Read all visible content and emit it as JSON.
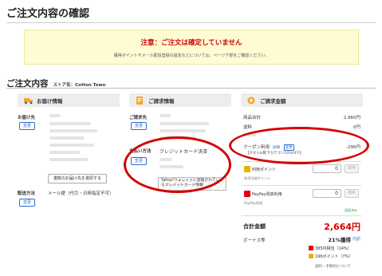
{
  "page": {
    "title": "ご注文内容の確認"
  },
  "notice": {
    "title": "注意：ご注文は確定していません",
    "message": "獲得ポイントやメール配信登録の設定などについては、ページ下部をご確認ください。"
  },
  "order": {
    "heading": "ご注文内容",
    "store_label": "ストア名：Cotton Town"
  },
  "delivery": {
    "header": "お届け情報",
    "destination_label": "お届け先",
    "change_label": "変更",
    "select_other_button": "複数のお届け先を選択する",
    "method_label": "配送方法",
    "method_value": "メール便（代引・日時指定不可）"
  },
  "billing": {
    "header": "ご請求情報",
    "billing_label": "ご請求先",
    "change_label": "変更",
    "payment_label": "支払い方法",
    "payment_value": "クレジットカード決済",
    "yahoo_wallet_note": "Yahoo!ウォレットに登録されているクレジットカード情報"
  },
  "amount": {
    "header": "ご請求金額",
    "subtotal_label": "商品合計",
    "subtotal_value": "2,960円",
    "shipping_label": "送料",
    "shipping_value": "0円",
    "coupon_label": "クーポン利用",
    "coupon_detail_label": "詳細",
    "coupon_change_label": "変更",
    "coupon_value": "-296円",
    "coupon_desc": "【タオル&靴下カテゴリ10%OFF】",
    "points_label": "利用ポイント",
    "points_value": "0",
    "points_apply": "適用",
    "points_note": "利用可能ポイント",
    "paypay_label": "PayPay残高利用",
    "paypay_value": "0",
    "paypay_apply": "適用",
    "paypay_note": "PayPay残高",
    "secure_badge": "認証済み",
    "total_label": "合計金額",
    "total_value": "2,664円",
    "bonus_label": "ボーナス等",
    "bonus_value": "21%獲得",
    "bonus_detail": "内訳",
    "bonus_line1": "385円相当（14%）",
    "bonus_line2": "196ポイント（7%）",
    "footer_note": "送料・手数料について"
  },
  "colors": {
    "accent": "#2e6fd1",
    "warning": "#d60000",
    "annotation": "#d40000",
    "notice_bg": "#fffbd3"
  }
}
